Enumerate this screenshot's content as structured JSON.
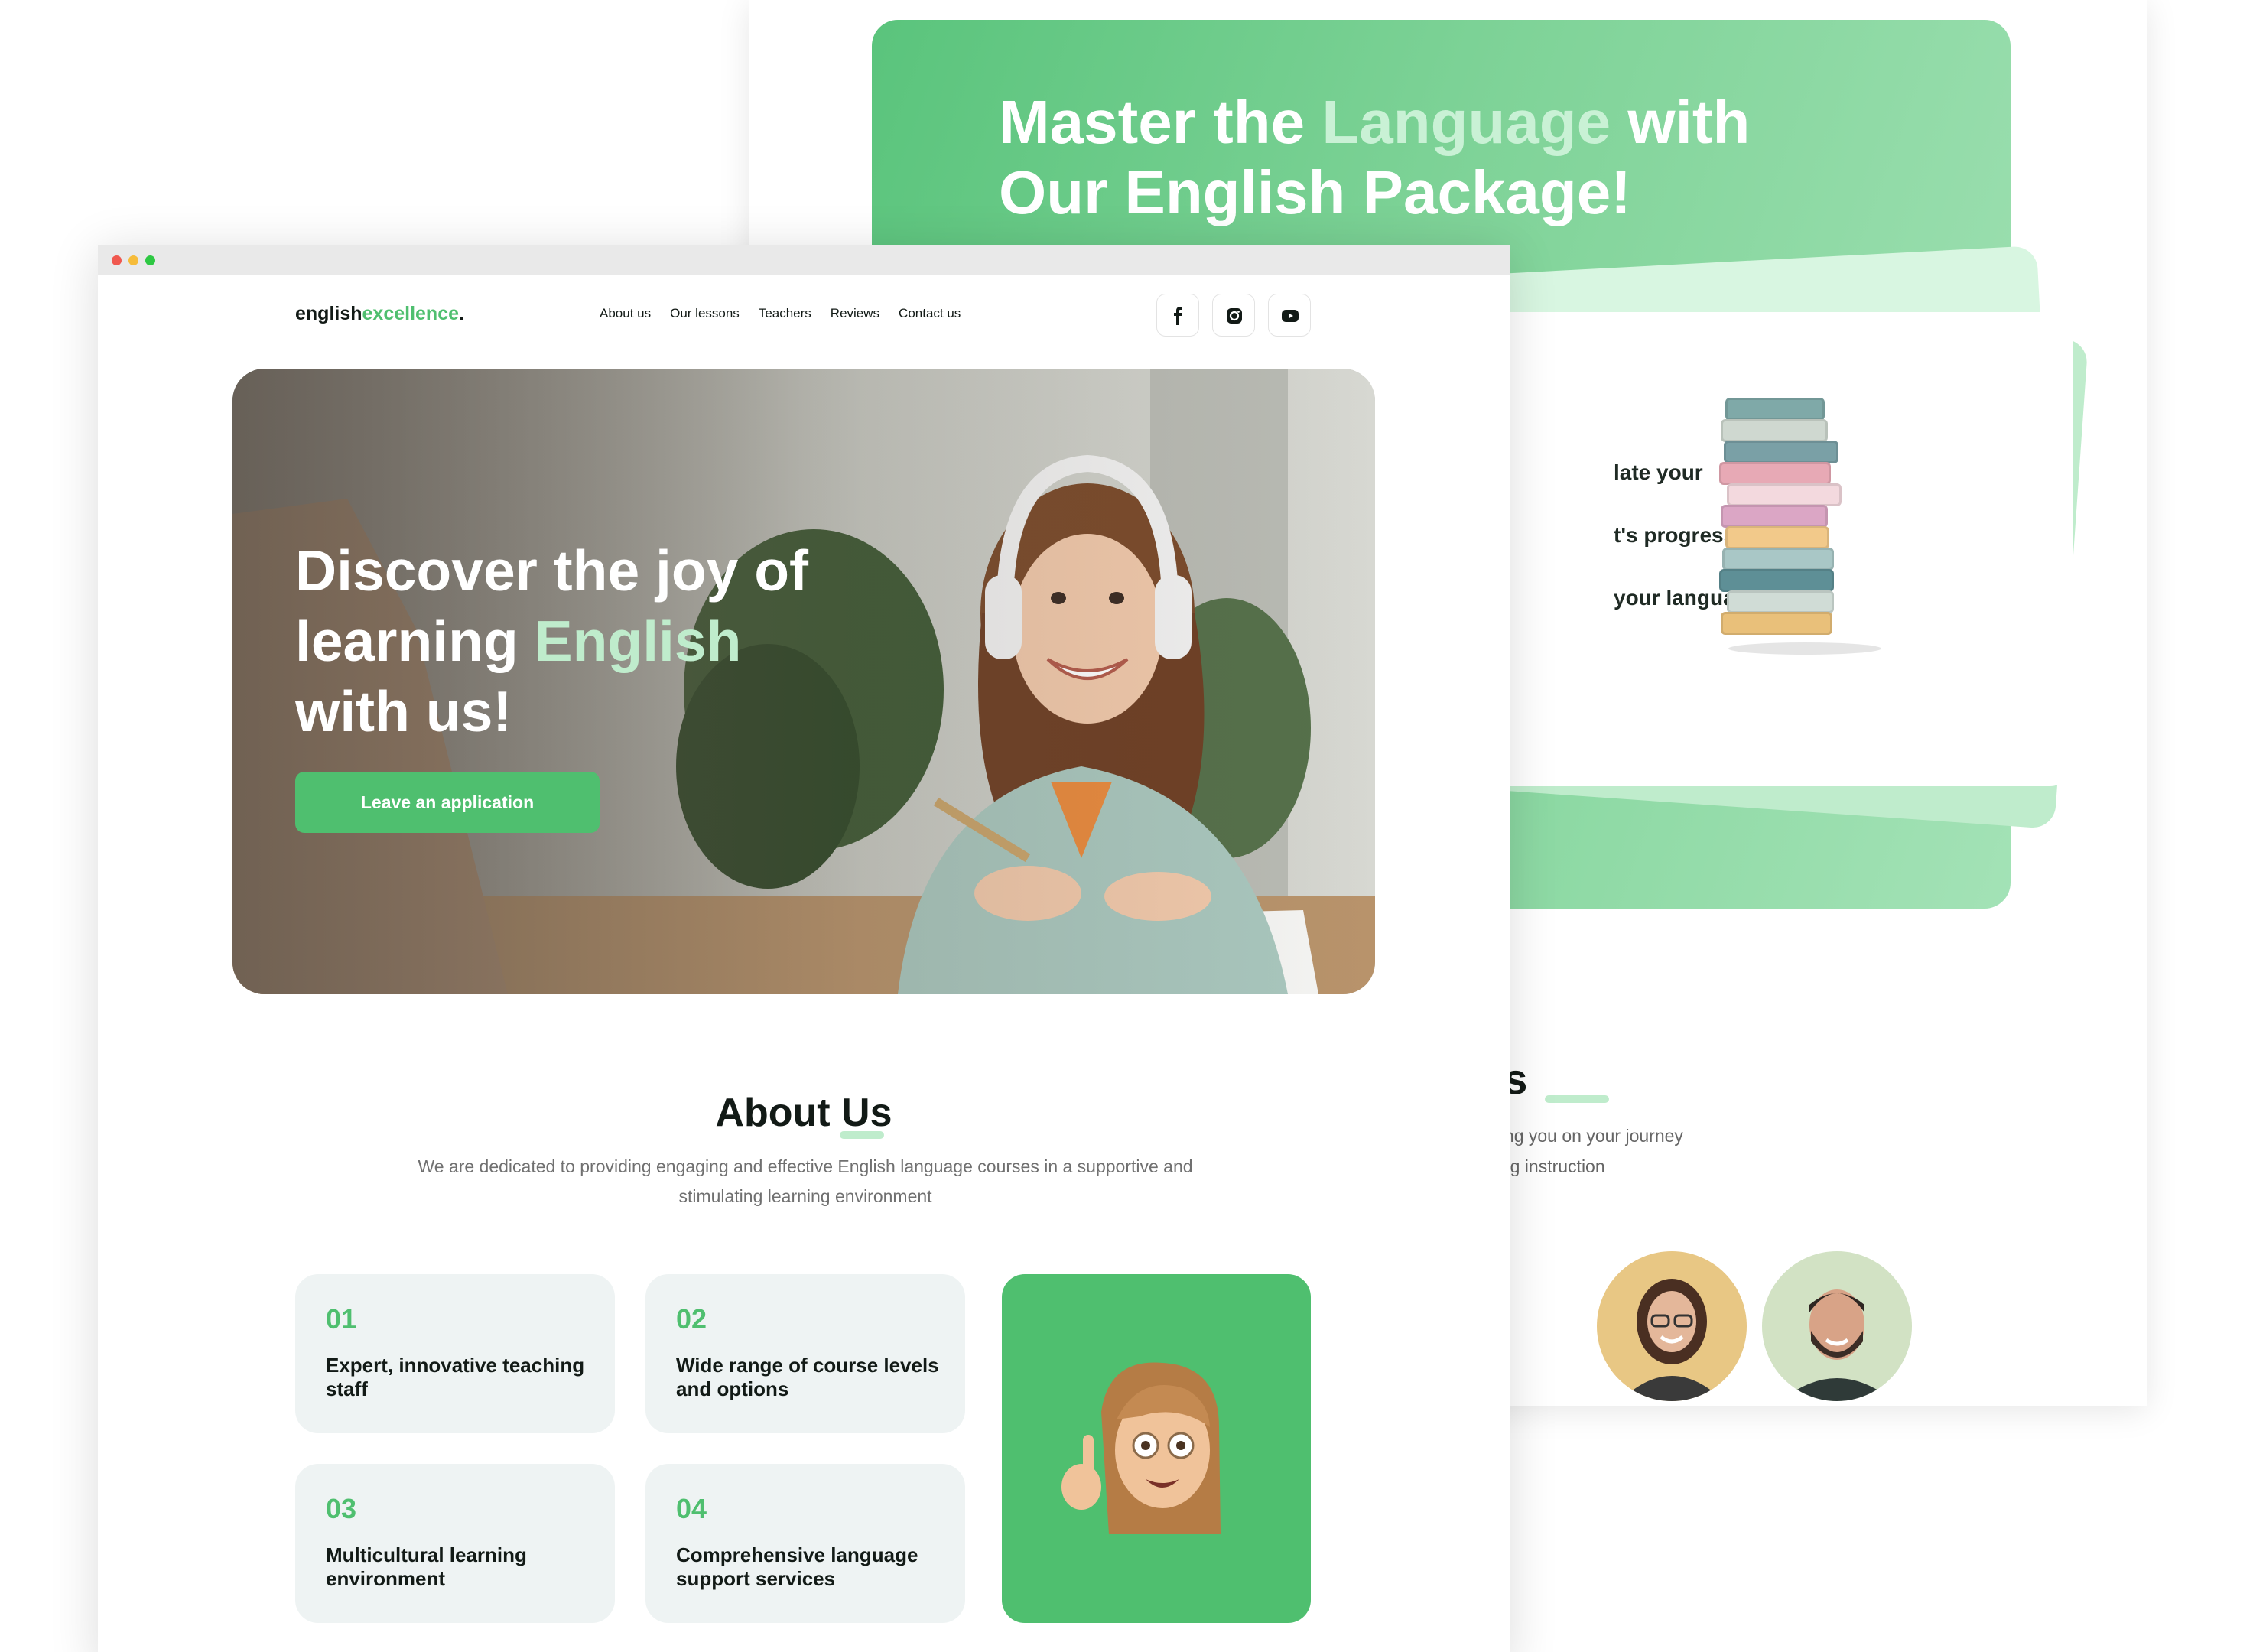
{
  "colors": {
    "accent": "#4fbf6f",
    "accent_light": "#bfeccc",
    "text": "#121a16",
    "card": "#eef3f3"
  },
  "back": {
    "package_title_1a": "Master the ",
    "package_title_1b": "Language",
    "package_title_1c": " with",
    "package_title_2": "Our English Package!",
    "package_items": [
      "late your",
      "t's progress",
      "your language"
    ],
    "teachers_title": "chers",
    "teachers_sub_1": "tted to guiding you on your journey",
    "teachers_sub_2": "and engaging instruction"
  },
  "window": {
    "dots": [
      "#f0584f",
      "#f6bc3a",
      "#2ec843"
    ]
  },
  "logo": {
    "part1": "english",
    "part2": "excellence",
    "dot": "."
  },
  "nav": [
    "About us",
    "Our lessons",
    "Teachers",
    "Reviews",
    "Contact us"
  ],
  "social": [
    "facebook-icon",
    "instagram-icon",
    "youtube-icon"
  ],
  "hero": {
    "line1": "Discover the joy of",
    "line2a": "learning ",
    "line2b": "English",
    "line3": "with us!",
    "cta": "Leave an application"
  },
  "about": {
    "title": "About Us",
    "description": "We are dedicated to providing engaging and effective English language courses in a supportive and stimulating learning environment",
    "features": [
      {
        "num": "01",
        "text": "Expert, innovative teaching staff"
      },
      {
        "num": "02",
        "text": "Wide range of course levels and options"
      },
      {
        "num": "03",
        "text": "Multicultural learning environment"
      },
      {
        "num": "04",
        "text": "Comprehensive language support services"
      }
    ]
  }
}
